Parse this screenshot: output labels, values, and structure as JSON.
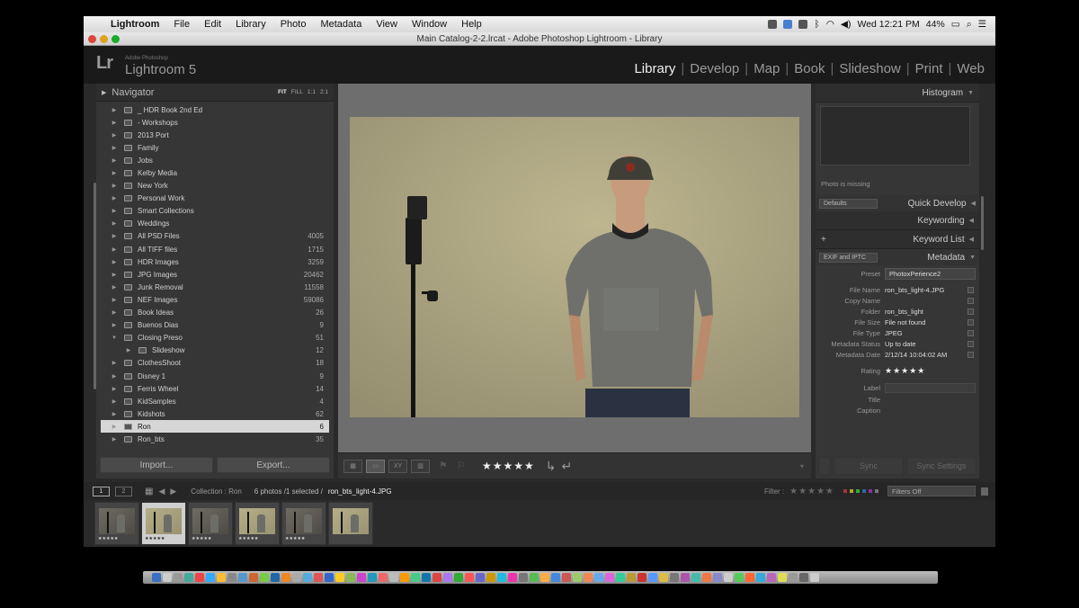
{
  "menubar": {
    "app": "Lightroom",
    "items": [
      "File",
      "Edit",
      "Library",
      "Photo",
      "Metadata",
      "View",
      "Window",
      "Help"
    ],
    "clock": "Wed 12:21 PM",
    "battery": "44%"
  },
  "window": {
    "title": "Main Catalog-2-2.lrcat - Adobe Photoshop Lightroom - Library"
  },
  "identity": {
    "adobe": "Adobe Photoshop",
    "product": "Lightroom 5",
    "lr": "Lr"
  },
  "modules": [
    "Library",
    "Develop",
    "Map",
    "Book",
    "Slideshow",
    "Print",
    "Web"
  ],
  "navigator": {
    "title": "Navigator",
    "zoom": [
      "FIT",
      "FILL",
      "1:1",
      "2:1"
    ]
  },
  "collections": [
    {
      "name": "_ HDR Book 2nd Ed",
      "count": "",
      "level": 0
    },
    {
      "name": "- Workshops",
      "count": "",
      "level": 0
    },
    {
      "name": "2013 Port",
      "count": "",
      "level": 0
    },
    {
      "name": "Family",
      "count": "",
      "level": 0
    },
    {
      "name": "Jobs",
      "count": "",
      "level": 0
    },
    {
      "name": "Kelby Media",
      "count": "",
      "level": 0
    },
    {
      "name": "New York",
      "count": "",
      "level": 0
    },
    {
      "name": "Personal Work",
      "count": "",
      "level": 0
    },
    {
      "name": "Smart Collections",
      "count": "",
      "level": 0
    },
    {
      "name": "Weddings",
      "count": "",
      "level": 0
    },
    {
      "name": "All PSD Files",
      "count": "4005",
      "level": 0
    },
    {
      "name": "All TIFF files",
      "count": "1715",
      "level": 0
    },
    {
      "name": "HDR Images",
      "count": "3259",
      "level": 0
    },
    {
      "name": "JPG Images",
      "count": "20462",
      "level": 0
    },
    {
      "name": "Junk Removal",
      "count": "11558",
      "level": 0
    },
    {
      "name": "NEF Images",
      "count": "59086",
      "level": 0
    },
    {
      "name": "Book Ideas",
      "count": "26",
      "level": 0
    },
    {
      "name": "Buenos Dias",
      "count": "9",
      "level": 0
    },
    {
      "name": "Closing Preso",
      "count": "51",
      "level": 0,
      "expanded": true
    },
    {
      "name": "Slideshow",
      "count": "12",
      "level": 1
    },
    {
      "name": "ClothesShoot",
      "count": "18",
      "level": 0
    },
    {
      "name": "Disney 1",
      "count": "9",
      "level": 0
    },
    {
      "name": "Ferris Wheel",
      "count": "14",
      "level": 0
    },
    {
      "name": "KidSamples",
      "count": "4",
      "level": 0
    },
    {
      "name": "Kidshots",
      "count": "62",
      "level": 0
    },
    {
      "name": "Ron",
      "count": "6",
      "level": 0,
      "selected": true
    },
    {
      "name": "Ron_bts",
      "count": "35",
      "level": 0
    }
  ],
  "left_buttons": {
    "import": "Import...",
    "export": "Export..."
  },
  "toolbar": {
    "stars": "★★★★★"
  },
  "right": {
    "histogram": "Histogram",
    "photo_missing": "Photo is missing",
    "defaults": "Defaults",
    "quick_develop": "Quick Develop",
    "keywording": "Keywording",
    "keyword_list": "Keyword List",
    "plus": "+",
    "exif_select": "EXIF and IPTC",
    "metadata": "Metadata",
    "preset_label": "Preset",
    "preset_value": "PhotoxPerience2",
    "fields": [
      {
        "label": "File Name",
        "value": "ron_bts_light-4.JPG"
      },
      {
        "label": "Copy Name",
        "value": ""
      },
      {
        "label": "Folder",
        "value": "ron_bts_light"
      },
      {
        "label": "File Size",
        "value": "File not found"
      },
      {
        "label": "File Type",
        "value": "JPEG"
      },
      {
        "label": "Metadata Status",
        "value": "Up to date"
      },
      {
        "label": "Metadata Date",
        "value": "2/12/14 10:04:02 AM"
      }
    ],
    "rating_label": "Rating",
    "rating_value": "★★★★★",
    "label_label": "Label",
    "title_label": "Title",
    "caption_label": "Caption",
    "sync": "Sync",
    "sync_settings": "Sync Settings"
  },
  "filmstrip_bar": {
    "monitor1": "1",
    "monitor2": "2",
    "collection_label": "Collection : Ron",
    "count": "6 photos /1 selected /",
    "filename": "ron_bts_light-4.JPG",
    "filter_label": "Filter :",
    "filter_stars": "★★★★★",
    "filters_off": "Filters Off"
  },
  "thumbs": [
    {
      "stars": "★★★★★",
      "selected": false,
      "dark": true
    },
    {
      "stars": "★★★★★",
      "selected": true,
      "dark": false
    },
    {
      "stars": "★★★★★",
      "selected": false,
      "dark": true
    },
    {
      "stars": "★★★★★",
      "selected": false,
      "dark": false
    },
    {
      "stars": "★★★★★",
      "selected": false,
      "dark": true
    },
    {
      "stars": "",
      "selected": false,
      "dark": false
    }
  ],
  "colors": {
    "accent": "#f0f0f0",
    "panel": "#363636",
    "selected_row": "#d6d6d6"
  }
}
